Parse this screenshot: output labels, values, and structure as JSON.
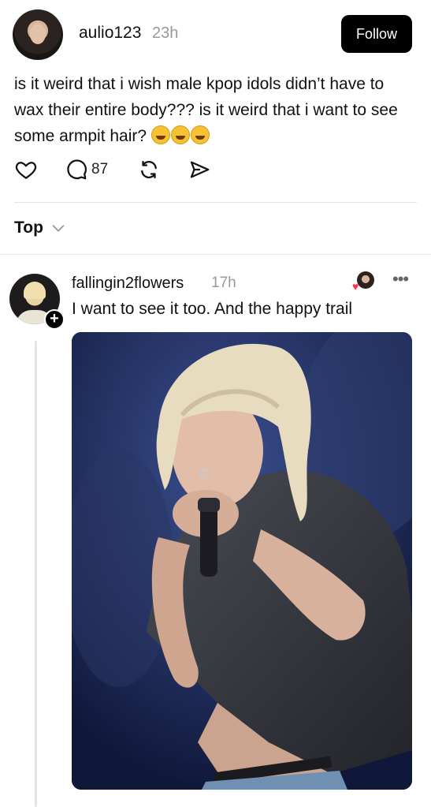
{
  "post": {
    "username": "aulio123",
    "time": "23h",
    "follow_label": "Follow",
    "text": "is it weird that i wish male kpop idols didn’t have to wax their entire body??? is it weird that i want to see some armpit hair?",
    "emoji_name": "rolling-on-floor-laughing",
    "emoji_count": 3,
    "reply_count": "87"
  },
  "sort": {
    "label": "Top"
  },
  "reply": {
    "username": "fallingin2flowers",
    "time": "17h",
    "text": "I want to see it too. And the happy trail",
    "image_alt": "Blonde performer holding a microphone to their face on stage"
  },
  "icons": {
    "like": "heart-icon",
    "reply": "comment-icon",
    "repost": "repost-icon",
    "share": "share-icon",
    "sort": "chevron-down-icon",
    "more": "more-icon",
    "add": "plus-icon"
  },
  "colors": {
    "follow_bg": "#000000",
    "meta_text": "#999999",
    "heart": "#ff3040"
  }
}
